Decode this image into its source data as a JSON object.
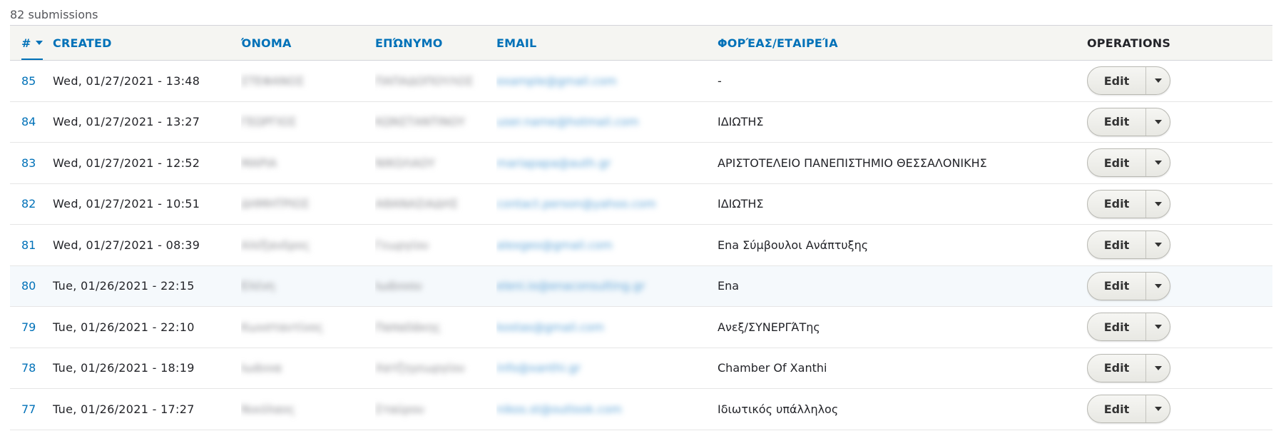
{
  "summary": "82 submissions",
  "columns": {
    "id": "#",
    "created": "CREATED",
    "onoma": "ΌΝΟΜΑ",
    "eponymo": "ΕΠΏΝΥΜΟ",
    "email": "EMAIL",
    "foreas": "ΦΟΡΈΑΣ/ΕΤΑΙΡΕΊΑ",
    "operations": "OPERATIONS"
  },
  "edit_label": "Edit",
  "icons": {
    "sort": "sort-descending-caret-icon",
    "dropdown": "chevron-down-icon"
  },
  "colors": {
    "link": "#0071b8",
    "header_bg": "#f5f5f2",
    "row_highlight": "#f5f9fc"
  },
  "rows": [
    {
      "id": "85",
      "created": "Wed, 01/27/2021 - 13:48",
      "onoma": "ΣΤΕΦΑΝΟΣ",
      "eponymo": "ΠΑΠΑΔΟΠΟΥΛΟΣ",
      "email": "example@gmail.com",
      "foreas": "-"
    },
    {
      "id": "84",
      "created": "Wed, 01/27/2021 - 13:27",
      "onoma": "ΓΕΩΡΓΙΟΣ",
      "eponymo": "ΚΩΝΣΤΑΝΤΙΝΟΥ",
      "email": "user.name@hotmail.com",
      "foreas": "ΙΔΙΩΤΗΣ"
    },
    {
      "id": "83",
      "created": "Wed, 01/27/2021 - 12:52",
      "onoma": "ΜΑΡΙΑ",
      "eponymo": "ΝΙΚΟΛΑΟΥ",
      "email": "mariapapa@auth.gr",
      "foreas": "ΑΡΙΣΤΟΤΕΛΕΙΟ ΠΑΝΕΠΙΣΤΗΜΙΟ ΘΕΣΣΑΛΟΝΙΚΗΣ"
    },
    {
      "id": "82",
      "created": "Wed, 01/27/2021 - 10:51",
      "onoma": "ΔΗΜΗΤΡΙΟΣ",
      "eponymo": "ΑΘΑΝΑΣΙΑΔΗΣ",
      "email": "contact.person@yahoo.com",
      "foreas": "ΙΔΙΩΤΗΣ"
    },
    {
      "id": "81",
      "created": "Wed, 01/27/2021 - 08:39",
      "onoma": "Αλέξανδρος",
      "eponymo": "Γεωργίου",
      "email": "alexgeo@gmail.com",
      "foreas": "Ena Σύμβουλοι Ανάπτυξης"
    },
    {
      "id": "80",
      "created": "Tue, 01/26/2021 - 22:15",
      "onoma": "Ελένη",
      "eponymo": "Ιωάννου",
      "email": "eleni.io@enaconsulting.gr",
      "foreas": "Ena"
    },
    {
      "id": "79",
      "created": "Tue, 01/26/2021 - 22:10",
      "onoma": "Κωνσταντίνος",
      "eponymo": "Παπαδάκης",
      "email": "kostas@gmail.com",
      "foreas": "Ανεξ/ΣΥΝΕΡΓΆΤης"
    },
    {
      "id": "78",
      "created": "Tue, 01/26/2021 - 18:19",
      "onoma": "Ιωάννα",
      "eponymo": "Χατζηγεωργίου",
      "email": "info@xanthi.gr",
      "foreas": "Chamber Of Xanthi"
    },
    {
      "id": "77",
      "created": "Tue, 01/26/2021 - 17:27",
      "onoma": "Νικόλαος",
      "eponymo": "Σταύρου",
      "email": "nikos.st@outlook.com",
      "foreas": "Ιδιωτικός υπάλληλος"
    }
  ]
}
